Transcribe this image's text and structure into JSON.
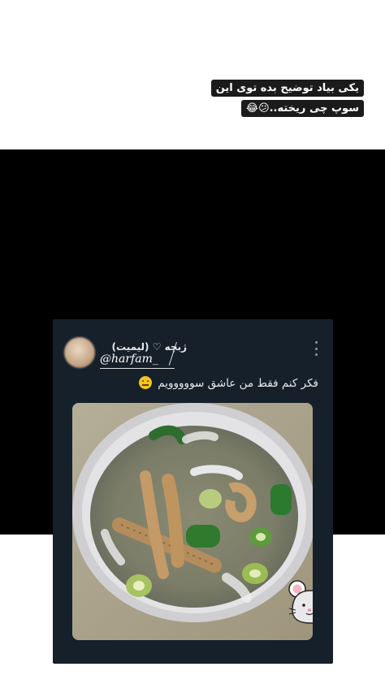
{
  "story": {
    "caption_line1": "یکی بیاد توضیح بده توی این",
    "caption_line2": "سوپ چی ریخته..😕😂"
  },
  "tweet": {
    "display_name": "ژبچه ♡ (لیمیت)",
    "handle": "@harfam_",
    "text": "فکر کنم فقط من عاشق سووووویم",
    "emoji_name": "neutral-face-emoji"
  },
  "icons": {
    "more": "more-vertical-icon",
    "sticker": "mouse-sticker"
  },
  "colors": {
    "card_bg": "#15202b",
    "band_bg": "#000000",
    "text_primary": "#e7e9ea"
  }
}
